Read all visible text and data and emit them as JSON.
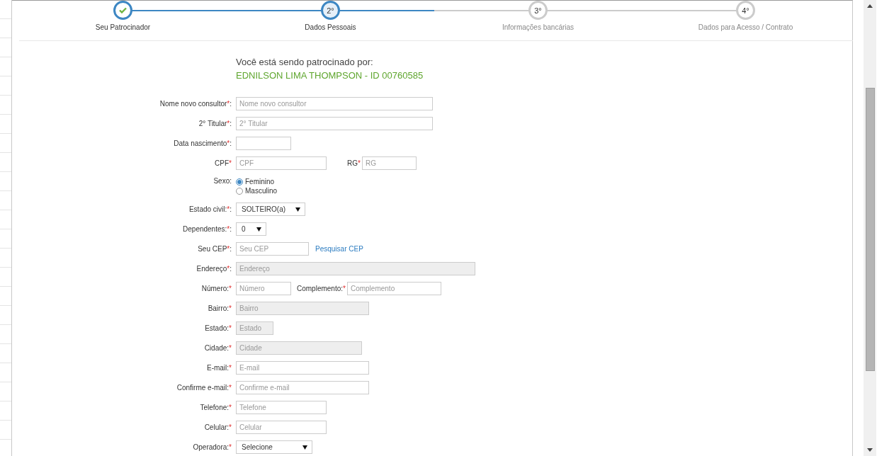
{
  "stepper": {
    "level": 0.5,
    "steps": [
      {
        "label": "Seu Patrocinador",
        "completed": true,
        "selected": false
      },
      {
        "number": "2°",
        "label": "Dados Pessoais",
        "completed": false,
        "selected": true
      },
      {
        "number": "3°",
        "label": "Informações bancárias",
        "completed": false,
        "selected": false
      },
      {
        "number": "4°",
        "label": "Dados para Acesso / Contrato",
        "completed": false,
        "selected": false
      }
    ]
  },
  "sponsor": {
    "intro": "Você está sendo patrocinado por:",
    "name": "EDNILSON LIMA THOMPSON - ID 00760585"
  },
  "form": [
    {
      "kind": "text",
      "label": "Nome novo consultor",
      "mark": "*",
      "suffix": ":",
      "placeholder": "Nome novo consultor",
      "disabled": false
    },
    {
      "kind": "text",
      "label": "2° Titular",
      "mark": "*",
      "suffix": ":",
      "placeholder": "2° Titular",
      "disabled": false
    },
    {
      "kind": "text",
      "label": "Data nascimento",
      "mark": "*",
      "suffix": ":",
      "disabled": false
    },
    {
      "kind": "text",
      "label": "CPF",
      "mark": "*",
      "placeholder": "CPF",
      "disabled": false,
      "second": {
        "label": "RG",
        "mark": "*",
        "placeholder": "RG",
        "disabled": false
      }
    },
    {
      "kind": "radio",
      "label": "Sexo:",
      "options": [
        {
          "label": "Feminino",
          "selected": true
        },
        {
          "label": "Masculino",
          "selected": false
        }
      ]
    },
    {
      "kind": "select",
      "label": "Estado civil:",
      "mark": "*",
      "suffix": ":",
      "value": "SOLTEIRO(a)"
    },
    {
      "kind": "select",
      "label": "Dependentes:",
      "mark": "*",
      "suffix": ":",
      "value": "0"
    },
    {
      "kind": "text",
      "label": "Seu CEP",
      "mark": "*",
      "suffix": ":",
      "placeholder": "Seu CEP",
      "disabled": false,
      "link": "Pesquisar CEP"
    },
    {
      "kind": "text",
      "label": "Endereço",
      "mark": "*",
      "suffix": ":",
      "placeholder": "Endereço",
      "disabled": true
    },
    {
      "kind": "text",
      "label": "Número:",
      "mark": "*",
      "placeholder": "Número",
      "disabled": false,
      "second": {
        "label": "Complemento:",
        "mark": "*",
        "placeholder": "Complemento",
        "disabled": false
      }
    },
    {
      "kind": "text",
      "label": "Bairro:",
      "mark": "*",
      "placeholder": "Bairro",
      "disabled": true
    },
    {
      "kind": "text",
      "label": "Estado:",
      "mark": "*",
      "placeholder": "Estado",
      "disabled": true
    },
    {
      "kind": "text",
      "label": "Cidade:",
      "mark": "*",
      "placeholder": "Cidade",
      "disabled": true
    },
    {
      "kind": "text",
      "label": "E-mail:",
      "mark": "*",
      "placeholder": "E-mail",
      "disabled": false
    },
    {
      "kind": "text",
      "label": "Confirme e-mail:",
      "mark": "*",
      "placeholder": "Confirme e-mail",
      "disabled": false
    },
    {
      "kind": "text",
      "label": "Telefone:",
      "mark": "*",
      "placeholder": "Telefone",
      "disabled": false
    },
    {
      "kind": "text",
      "label": "Celular:",
      "mark": "*",
      "placeholder": "Celular",
      "disabled": false
    },
    {
      "kind": "select",
      "label": "Operadora:",
      "mark": "*",
      "value": "Selecione"
    }
  ]
}
